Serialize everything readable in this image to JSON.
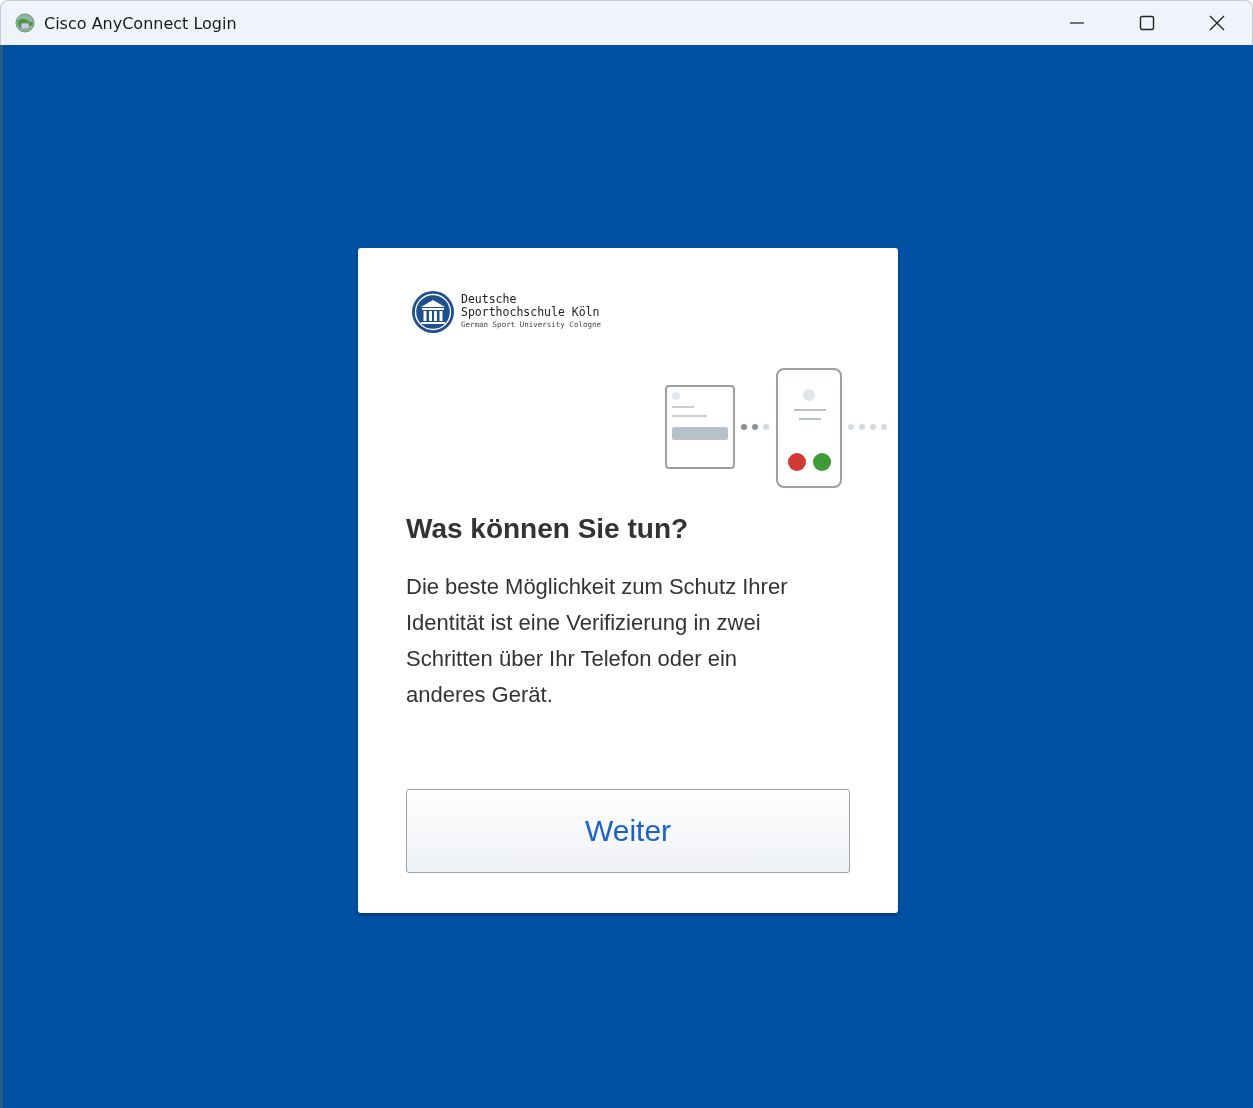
{
  "window": {
    "title": "Cisco AnyConnect Login"
  },
  "logo": {
    "name_line_1": "Deutsche",
    "name_line_2": "Sporthochschule Köln",
    "subtitle": "German Sport University Cologne"
  },
  "heading": "Was können Sie tun?",
  "body": "Die beste Möglichkeit zum Schutz Ihrer Identität ist eine Verifizierung in zwei Schritten über Ihr Telefon oder ein anderes Gerät.",
  "button": {
    "label": "Weiter"
  }
}
